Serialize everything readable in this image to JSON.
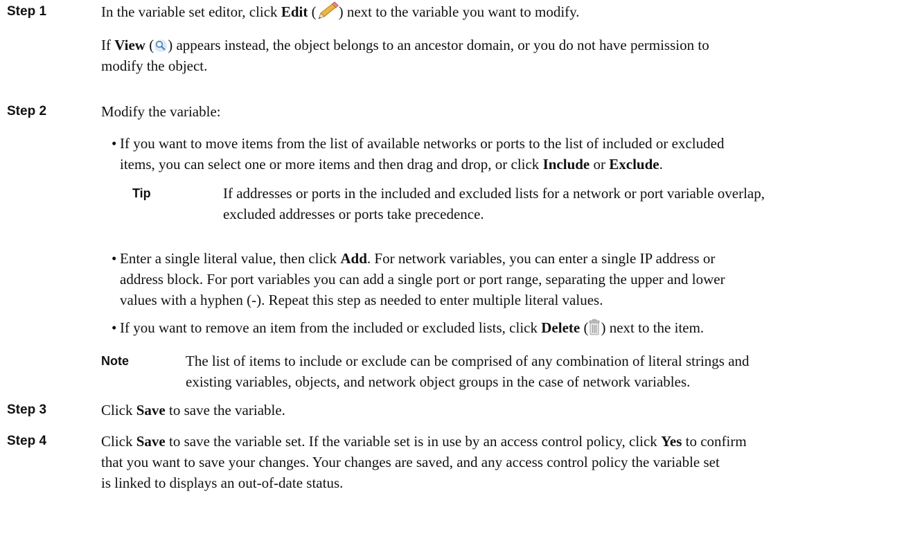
{
  "step1": {
    "label": "Step 1",
    "l1_a": "In the variable set editor, click ",
    "l1_bold": "Edit",
    "l1_b": " (",
    "l1_c": ") next to the variable you want to modify.",
    "l2_bold": "View",
    "l2_a": " (",
    "l2_b": ") appears instead, the object belongs to an ancestor domain, or you do not have permission to",
    "l2_pre": "If ",
    "l3": "modify the object.",
    "edit_icon": "pencil-icon",
    "view_icon": "magnifier-icon"
  },
  "step2": {
    "label": "Step 2",
    "intro": "Modify the variable:",
    "b1_l1": "If you want to move items from the list of available networks or ports to the list of included or excluded",
    "b1_l2a": "items, you can select one or more items and then drag and drop, or click ",
    "b1_include": "Include",
    "b1_or": " or ",
    "b1_exclude": "Exclude",
    "b1_end": ".",
    "tip_label": "Tip",
    "tip_l1": "If addresses or ports in the included and excluded lists for a network or port variable overlap,",
    "tip_l2": "excluded addresses or ports take precedence.",
    "b2_l1a": "Enter a single literal value, then click ",
    "b2_add": "Add",
    "b2_l1b": ". For network variables, you can enter a single IP address or",
    "b2_l2": "address block. For port variables you can add a single port or port range, separating the upper and lower",
    "b2_l3": "values with a hyphen (-). Repeat this step as needed to enter multiple literal values.",
    "b3_a": "If you want to remove an item from the included or excluded lists, click ",
    "b3_delete": "Delete",
    "b3_b": " (",
    "b3_c": ") next to the item.",
    "delete_icon": "trash-icon",
    "note_label": "Note",
    "note_l1": "The list of items to include or exclude can be comprised of any combination of literal strings and",
    "note_l2": "existing variables, objects, and network object groups in the case of network variables."
  },
  "step3": {
    "label": "Step 3",
    "a": "Click ",
    "save": "Save",
    "b": " to save the variable."
  },
  "step4": {
    "label": "Step 4",
    "a": "Click ",
    "save": "Save",
    "b": " to save the variable set. If the variable set is in use by an access control policy, click ",
    "yes": "Yes",
    "c": " to confirm",
    "l2": "that you want to save your changes. Your changes are saved, and any access control policy the variable set",
    "l3": "is linked to displays an out-of-date status."
  }
}
